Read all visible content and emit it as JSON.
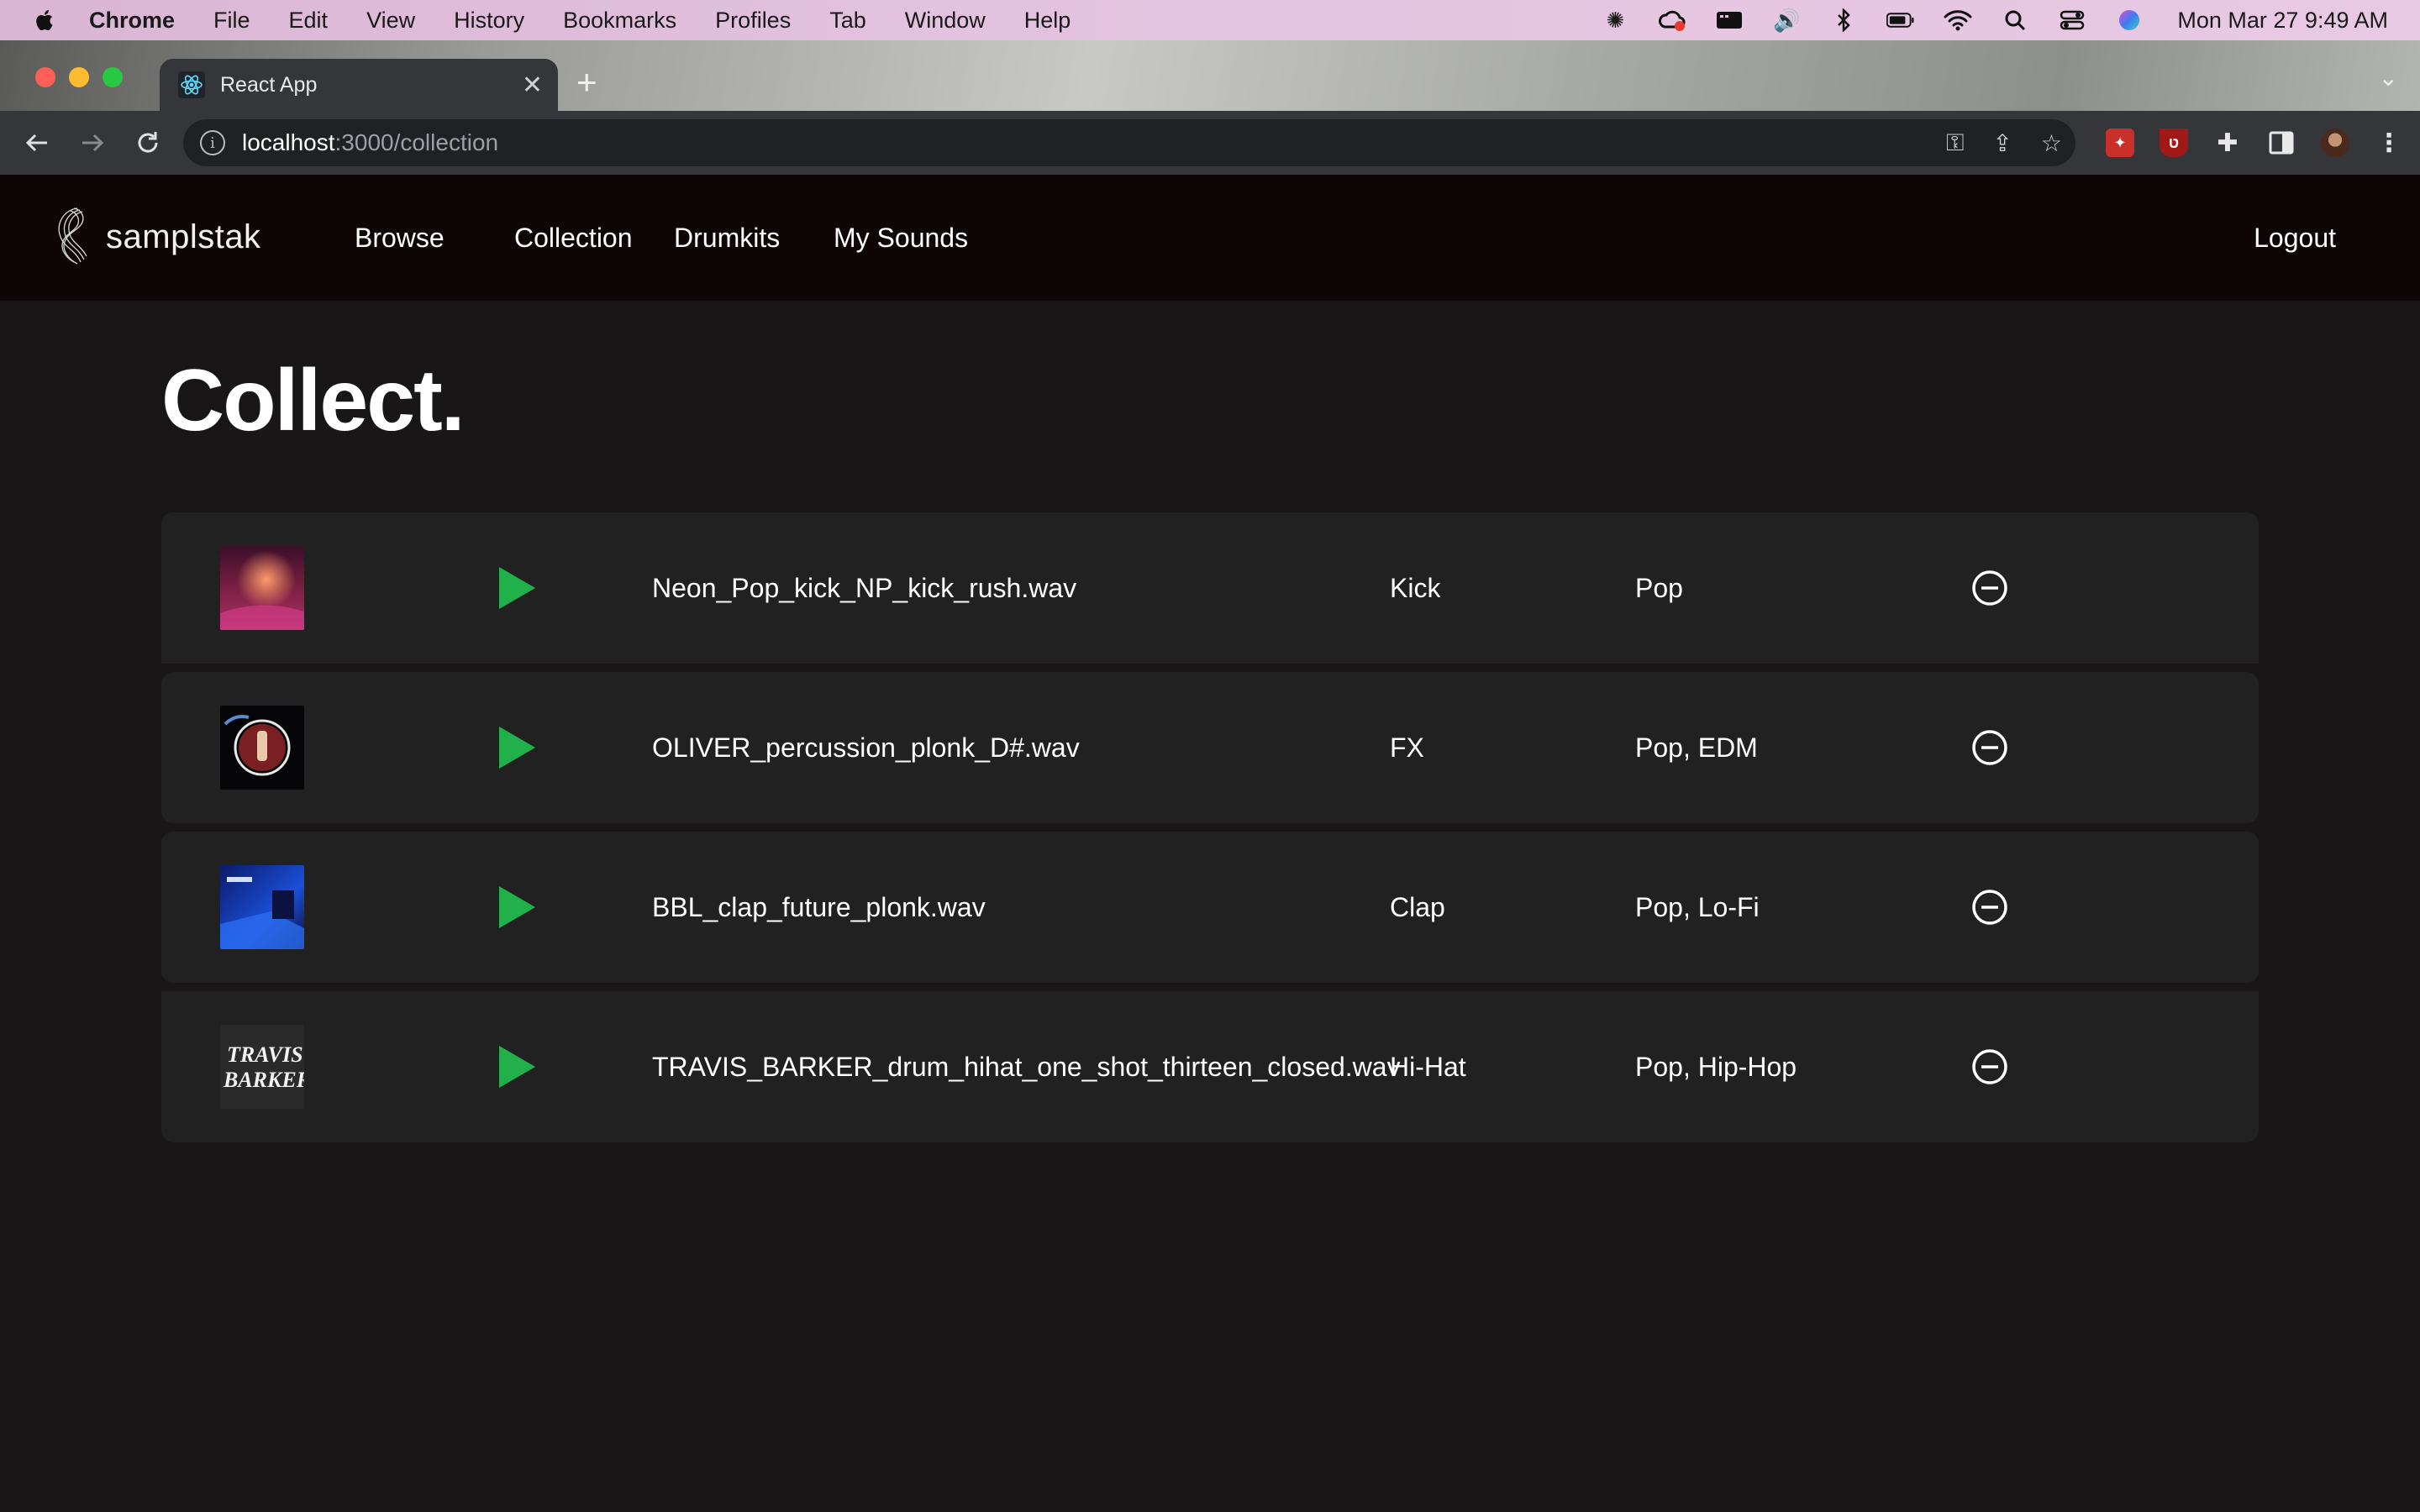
{
  "menubar": {
    "app_name": "Chrome",
    "items": [
      "File",
      "Edit",
      "View",
      "History",
      "Bookmarks",
      "Profiles",
      "Tab",
      "Window",
      "Help"
    ],
    "clock": "Mon Mar 27  9:49 AM"
  },
  "browser": {
    "tab_title": "React App",
    "url_host": "localhost",
    "url_path": ":3000/collection"
  },
  "header": {
    "logo_text": "samplstak",
    "nav": [
      "Browse",
      "Collection",
      "Drumkits",
      "My Sounds"
    ],
    "logout_label": "Logout"
  },
  "page": {
    "title": "Collect."
  },
  "collection": [
    {
      "filename": "Neon_Pop_kick_NP_kick_rush.wav",
      "type": "Kick",
      "genres": "Pop",
      "cover": "neon-pop-cover"
    },
    {
      "filename": "OLIVER_percussion_plonk_D#.wav",
      "type": "FX",
      "genres": "Pop, EDM",
      "cover": "oliver-cover"
    },
    {
      "filename": "BBL_clap_future_plonk.wav",
      "type": "Clap",
      "genres": "Pop, Lo-Fi",
      "cover": "bbl-cover"
    },
    {
      "filename": "TRAVIS_BARKER_drum_hihat_one_shot_thirteen_closed.wav",
      "type": "Hi-Hat",
      "genres": "Pop, Hip-Hop",
      "cover": "travis-barker-cover",
      "cover_text": "TRAVIS BARKER"
    }
  ],
  "colors": {
    "play": "#22b04b",
    "header_bg": "#0e0606",
    "page_bg": "#181616",
    "row_bg": "#222121"
  }
}
